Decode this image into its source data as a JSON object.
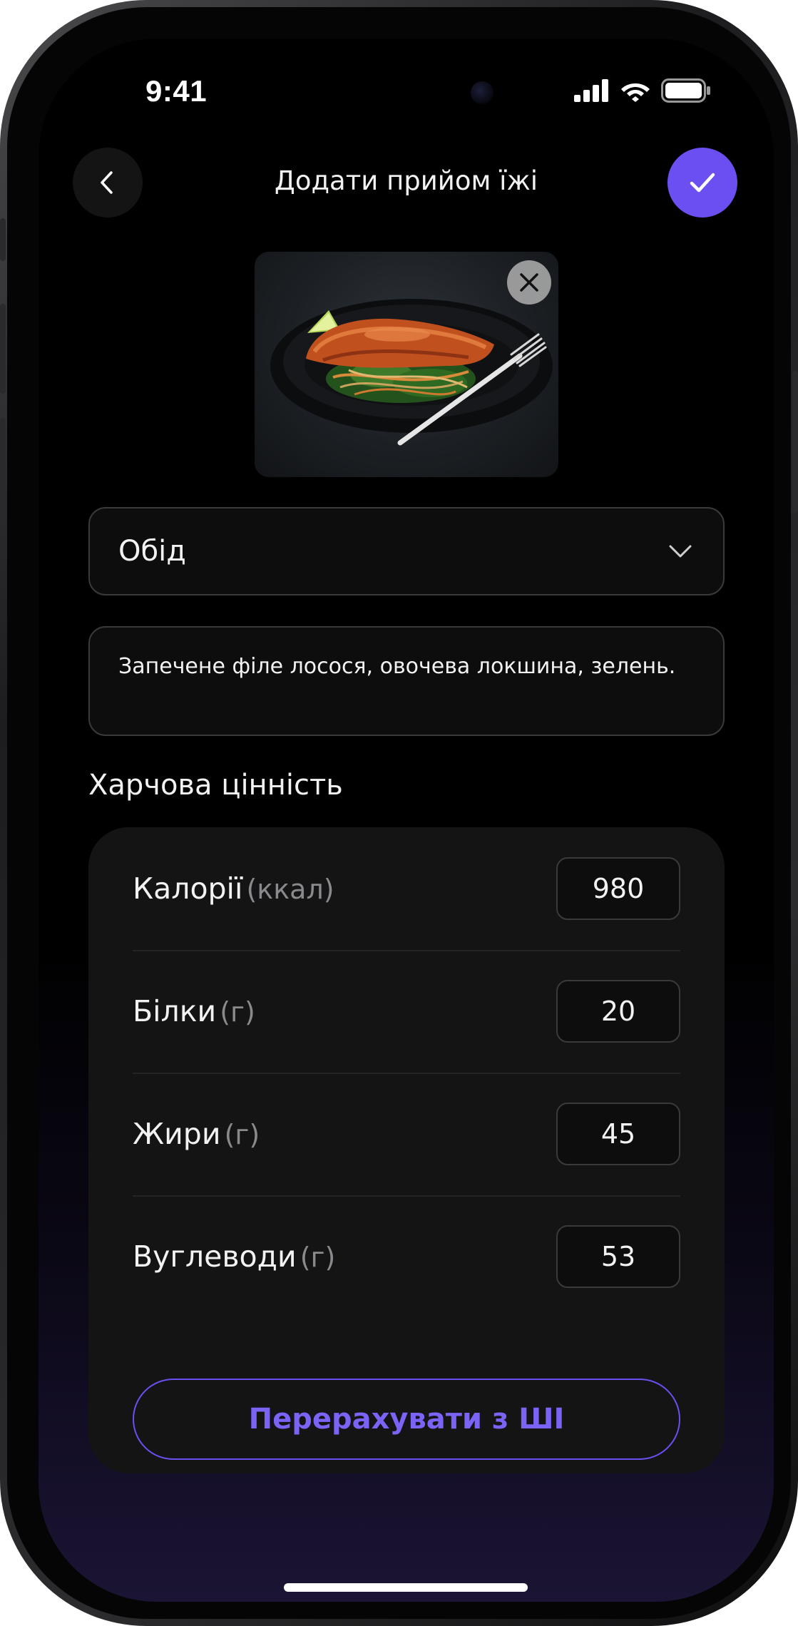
{
  "status_bar": {
    "time": "9:41"
  },
  "header": {
    "title": "Додати прийом їжі",
    "back_icon": "chevron-left-icon",
    "confirm_icon": "checkmark-icon"
  },
  "photo": {
    "description": "meal photo",
    "remove_icon": "close-icon"
  },
  "meal_type": {
    "value": "Обід",
    "icon": "chevron-down-icon"
  },
  "description": {
    "value": "Запечене філе лосося, овочева локшина, зелень."
  },
  "nutrition": {
    "title": "Харчова цінність",
    "rows": [
      {
        "label": "Калорії",
        "unit": "(ккал)",
        "value": "980"
      },
      {
        "label": "Білки",
        "unit": "(г)",
        "value": "20"
      },
      {
        "label": "Жири",
        "unit": "(г)",
        "value": "45"
      },
      {
        "label": "Вуглеводи",
        "unit": "(г)",
        "value": "53"
      }
    ],
    "recalculate_label": "Перерахувати з ШІ"
  },
  "colors": {
    "accent": "#6b4ff0",
    "accent_text": "#7b63f5",
    "background": "#000000",
    "card": "#141414"
  }
}
